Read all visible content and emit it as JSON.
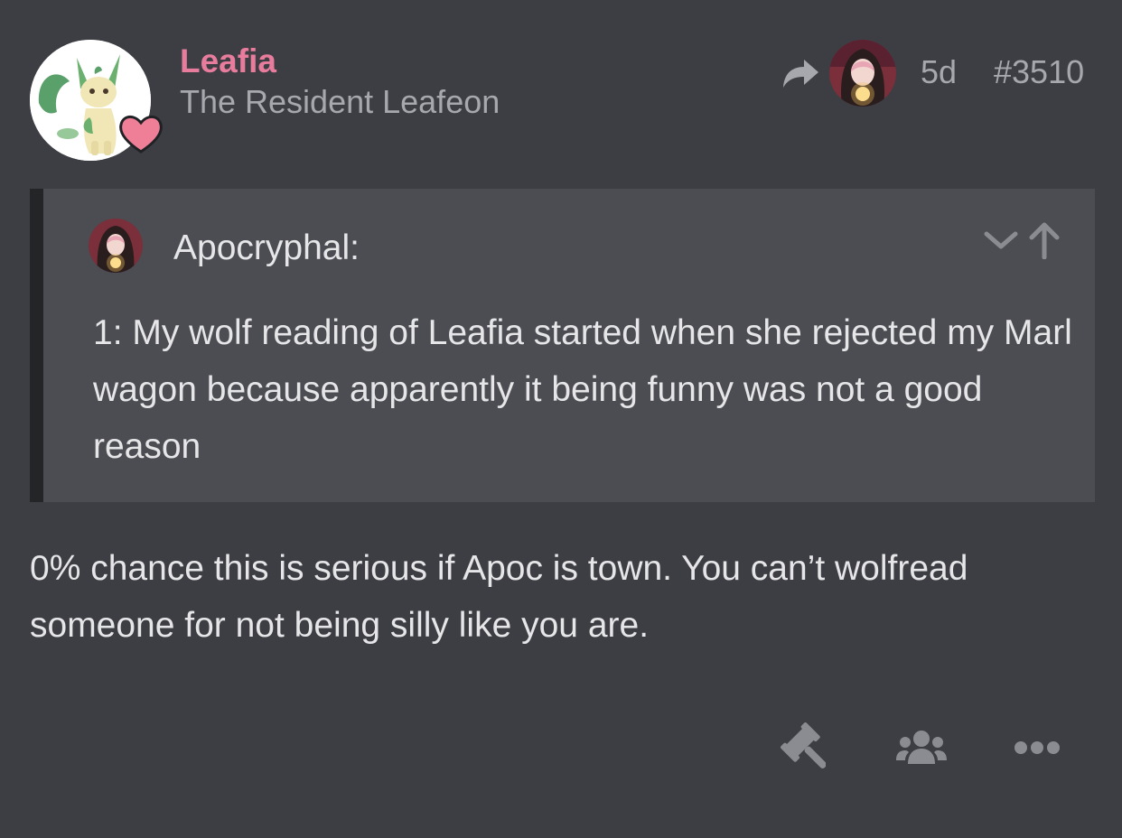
{
  "post": {
    "author": {
      "name": "Leafia",
      "title": "The Resident Leafeon",
      "avatar_icon": "leafeon-avatar",
      "badge_icon": "heart-icon",
      "name_color": "#e87c9d"
    },
    "meta": {
      "reply_icon": "reply-arrow-icon",
      "reply_to_avatar": "apocryphal-avatar",
      "age": "5d",
      "number": "#3510"
    },
    "quote": {
      "author": "Apocryphal:",
      "text": "1: My wolf reading of Leafia started when she rejected my Marl wagon because apparently it being funny was not a good reason",
      "expand_icon": "chevron-down-icon",
      "jump_icon": "arrow-up-icon"
    },
    "body": "0% chance this is serious if Apoc is town. You can’t wolfread someone for not being silly like you are.",
    "actions": [
      {
        "icon": "gavel-icon"
      },
      {
        "icon": "group-icon"
      },
      {
        "icon": "more-icon"
      }
    ]
  },
  "colors": {
    "background": "#3c3e43",
    "quote_background": "#4b4d52",
    "quote_border": "#242527",
    "text": "#e6e6e8",
    "muted": "#a6a8ad",
    "accent": "#e87c9d"
  }
}
